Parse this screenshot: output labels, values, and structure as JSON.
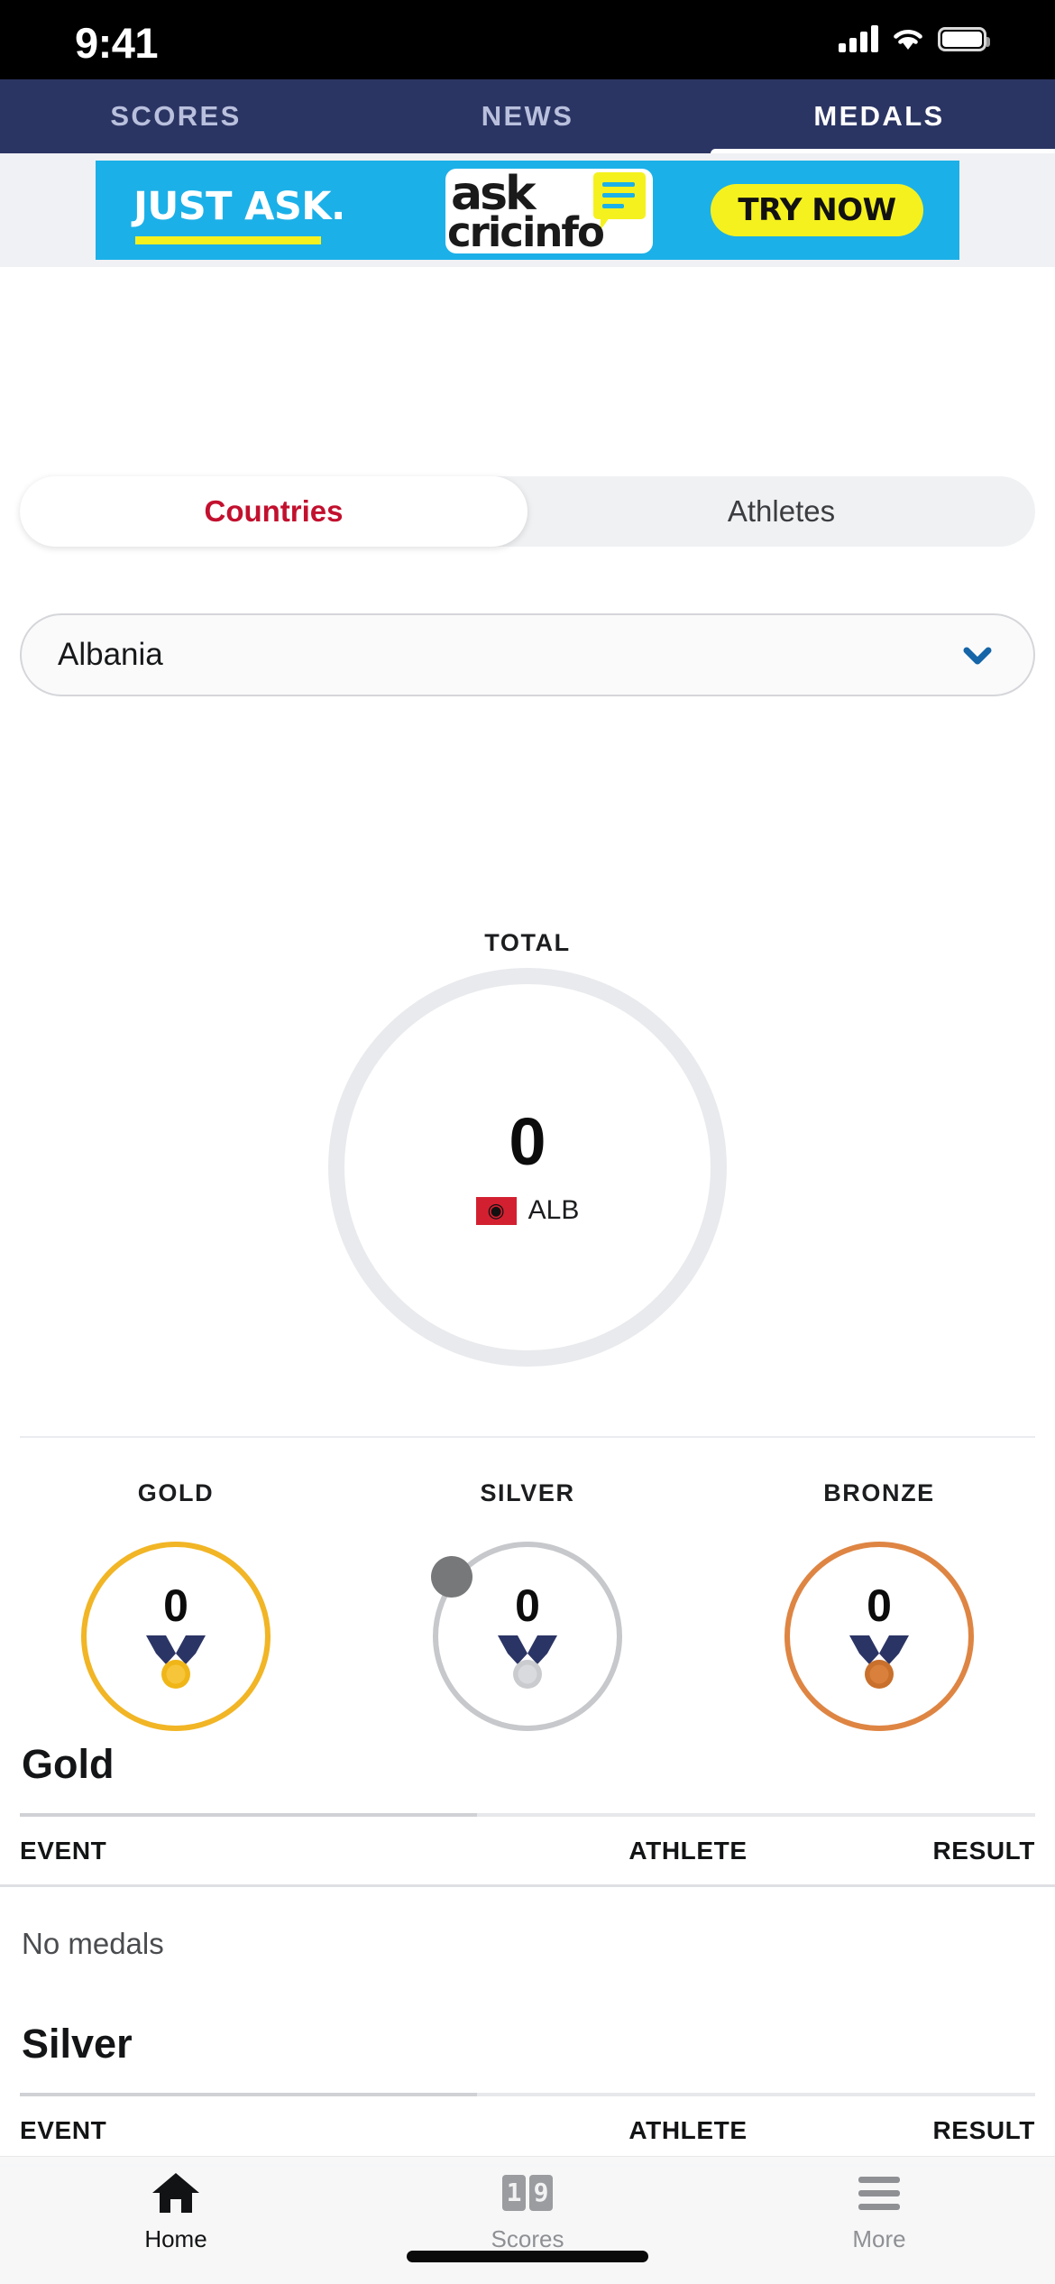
{
  "status_bar": {
    "time": "9:41",
    "cellular_icon": "cellular-signal-icon",
    "wifi_icon": "wifi-icon",
    "battery_icon": "battery-icon"
  },
  "top_nav": {
    "tabs": [
      {
        "label": "SCORES",
        "active": false
      },
      {
        "label": "NEWS",
        "active": false
      },
      {
        "label": "MEDALS",
        "active": true
      }
    ]
  },
  "ad": {
    "headline": "JUST ASK.",
    "logo_primary": "ask",
    "logo_secondary": "cricinfo",
    "cta_label": "TRY NOW",
    "background_color": "#1cb0e8",
    "accent_color": "#f5f11f"
  },
  "segmented_control": {
    "options": [
      {
        "label": "Countries",
        "active": true
      },
      {
        "label": "Athletes",
        "active": false
      }
    ],
    "active_color": "#c2102e"
  },
  "country_select": {
    "value": "Albania",
    "chevron_icon": "chevron-down-icon",
    "chevron_color": "#1565a8"
  },
  "total": {
    "label": "TOTAL",
    "count": "0",
    "country_abbr": "ALB",
    "flag_icon": "albania-flag-icon",
    "flag_color": "#d32030",
    "ring_color": "#e9eaed"
  },
  "medals": [
    {
      "label": "GOLD",
      "count": "0",
      "ring_color": "#f1b525",
      "disc_color": "#f0b618",
      "medal_icon": "gold-medal-icon",
      "has_knob": false
    },
    {
      "label": "SILVER",
      "count": "0",
      "ring_color": "#c6c8cb",
      "disc_color": "#c9cbce",
      "medal_icon": "silver-medal-icon",
      "has_knob": true
    },
    {
      "label": "BRONZE",
      "count": "0",
      "ring_color": "#de8543",
      "disc_color": "#d2762f",
      "medal_icon": "bronze-medal-icon",
      "has_knob": false
    }
  ],
  "table_headers": {
    "event": "EVENT",
    "athlete": "ATHLETE",
    "result": "RESULT"
  },
  "sections": [
    {
      "title": "Gold",
      "empty_text": "No medals"
    },
    {
      "title": "Silver",
      "empty_text": ""
    }
  ],
  "tab_bar": {
    "items": [
      {
        "label": "Home",
        "icon": "home-icon",
        "active": true
      },
      {
        "label": "Scores",
        "icon": "scoreboard-icon",
        "active": false
      },
      {
        "label": "More",
        "icon": "hamburger-icon",
        "active": false
      }
    ],
    "scoreboard_digits": [
      "1",
      "9"
    ]
  }
}
